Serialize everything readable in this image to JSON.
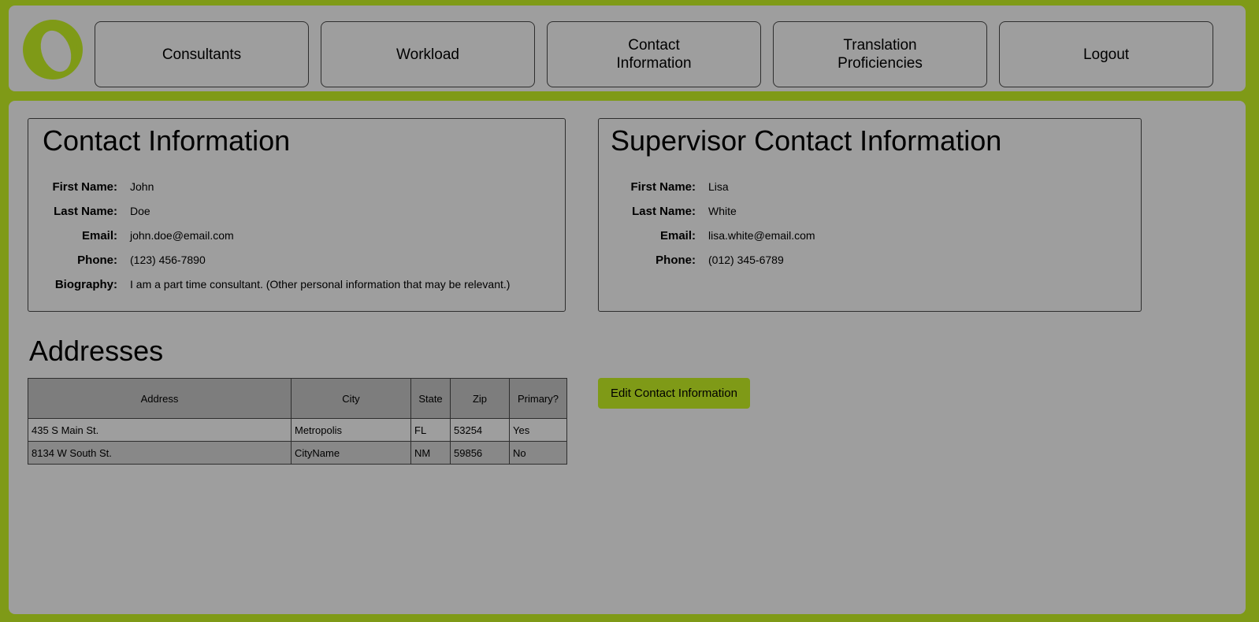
{
  "nav": {
    "items": [
      {
        "label": "Consultants"
      },
      {
        "label": "Workload"
      },
      {
        "label": "Contact\nInformation"
      },
      {
        "label": "Translation\nProficiencies"
      },
      {
        "label": "Logout"
      }
    ]
  },
  "contact": {
    "title": "Contact Information",
    "fields": [
      {
        "label": "First Name:",
        "value": "John"
      },
      {
        "label": "Last Name:",
        "value": "Doe"
      },
      {
        "label": "Email:",
        "value": "john.doe@email.com"
      },
      {
        "label": "Phone:",
        "value": "(123) 456-7890"
      },
      {
        "label": "Biography:",
        "value": "I am a part time consultant. (Other personal information that may be relevant.)"
      }
    ]
  },
  "supervisor": {
    "title": "Supervisor Contact Information",
    "fields": [
      {
        "label": "First Name:",
        "value": "Lisa"
      },
      {
        "label": "Last Name:",
        "value": "White"
      },
      {
        "label": "Email:",
        "value": "lisa.white@email.com"
      },
      {
        "label": "Phone:",
        "value": "(012) 345-6789"
      }
    ]
  },
  "addresses": {
    "title": "Addresses",
    "columns": [
      "Address",
      "City",
      "State",
      "Zip",
      "Primary?"
    ],
    "rows": [
      [
        "435 S Main St.",
        "Metropolis",
        "FL",
        "53254",
        "Yes"
      ],
      [
        "8134 W South St.",
        "CityName",
        "NM",
        "59856",
        "No"
      ]
    ]
  },
  "edit_button": {
    "label": "Edit Contact Information"
  },
  "colors": {
    "accent": "#7f9a17",
    "panel_bg": "#9e9e9e",
    "table_header": "#7d7d7d"
  },
  "icons": {
    "logo": "app-logo-icon"
  }
}
